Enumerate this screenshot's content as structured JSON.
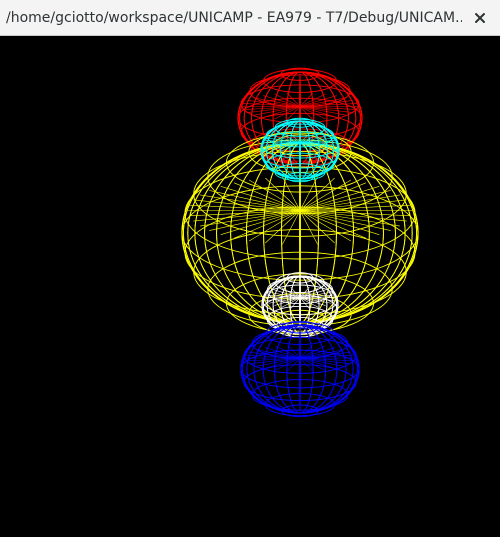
{
  "window": {
    "title": "/home/gciotto/workspace/UNICAMP - EA979 - T7/Debug/UNICAM..."
  },
  "titlebar_icons": {
    "close": "close-icon"
  },
  "scene": {
    "background": "#000000",
    "objects": [
      {
        "name": "red-sphere",
        "color": "#ff0000"
      },
      {
        "name": "yellow-sphere",
        "color": "#ffff00"
      },
      {
        "name": "cyan-sphere",
        "color": "#00ffff"
      },
      {
        "name": "white-sphere",
        "color": "#ffffff"
      },
      {
        "name": "blue-sphere",
        "color": "#0000ff"
      }
    ]
  }
}
